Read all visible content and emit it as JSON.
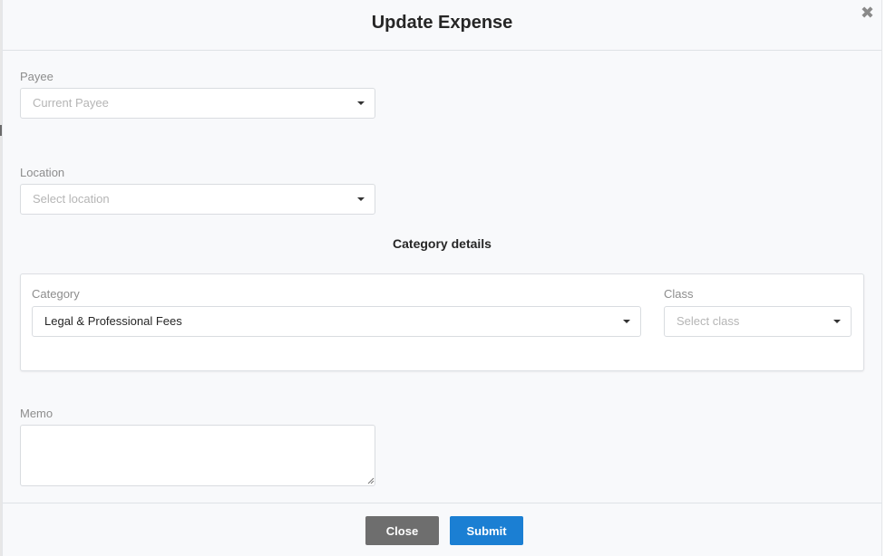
{
  "modal": {
    "title": "Update Expense",
    "close_icon": "close-icon"
  },
  "payee": {
    "label": "Payee",
    "value": "Current Payee"
  },
  "location": {
    "label": "Location",
    "placeholder": "Select location"
  },
  "category_details": {
    "section_title": "Category details",
    "category_label": "Category",
    "category_value": "Legal & Professional Fees",
    "class_label": "Class",
    "class_placeholder": "Select class"
  },
  "memo": {
    "label": "Memo",
    "value": ""
  },
  "footer": {
    "close_label": "Close",
    "submit_label": "Submit"
  },
  "colors": {
    "primary": "#1b7fd3",
    "secondary": "#6e6e6e",
    "background": "#f8f9fb"
  }
}
